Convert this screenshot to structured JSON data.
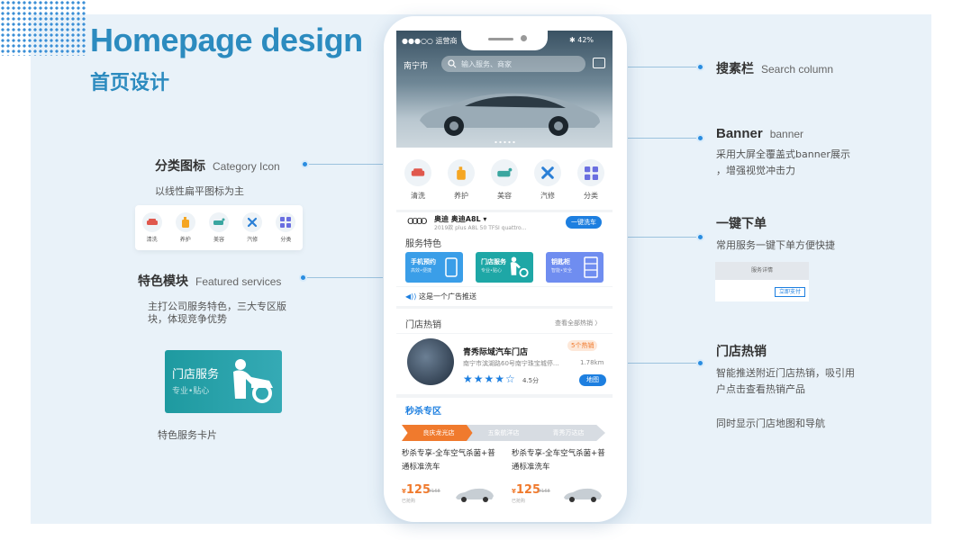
{
  "header": {
    "title_en": "Homepage design",
    "title_cn": "首页设计"
  },
  "annotations": {
    "category": {
      "title": "分类图标",
      "sub": "Category Icon",
      "desc": "以线性扁平图标为主"
    },
    "featured": {
      "title": "特色模块",
      "sub": "Featured services",
      "desc1": "主打公司服务特色，三大专区版",
      "desc2": "块，体现竞争优势"
    },
    "card_caption": "特色服务卡片",
    "search": {
      "title": "搜素栏",
      "sub": "Search column"
    },
    "banner": {
      "title": "Banner",
      "sub": "banner",
      "desc1": "采用大屏全覆盖式banner展示",
      "desc2": "，增强视觉冲击力"
    },
    "onekey": {
      "title": "一键下单",
      "desc": "常用服务一键下单方便快捷"
    },
    "hot": {
      "title": "门店热销",
      "desc1": "智能推送附近门店热销，吸引用",
      "desc2": "户点击查看热销产品",
      "desc3": "同时显示门店地图和导航"
    }
  },
  "phone": {
    "carrier": "●●●○○ 运营商",
    "battery": "✱ 42%",
    "city": "南宁市",
    "search_placeholder": "输入服务、商家",
    "categories": [
      {
        "label": "清洗",
        "icon": "car-wash-icon",
        "color": "#e0584d"
      },
      {
        "label": "养护",
        "icon": "oil-bottle-icon",
        "color": "#f5a623"
      },
      {
        "label": "美容",
        "icon": "car-beauty-icon",
        "color": "#3aa6a0"
      },
      {
        "label": "汽修",
        "icon": "wrench-icon",
        "color": "#2a7fd6"
      },
      {
        "label": "分类",
        "icon": "grid-icon",
        "color": "#6a6fe0"
      }
    ],
    "car": {
      "brand_logo": "OOOO",
      "name": "奥迪 奥迪A8L ▾",
      "desc": "2019款 plus  A8L 50 TFSI quattro...",
      "button": "一键洗车"
    },
    "service_title": "服务特色",
    "services": [
      {
        "title": "手机预约",
        "sub": "高效•便捷",
        "color": "#3a9ee8"
      },
      {
        "title": "门店服务",
        "sub": "专业•贴心",
        "color": "#1ea7a6"
      },
      {
        "title": "钥匙柜",
        "sub": "智能•安全",
        "color": "#6f8df0"
      }
    ],
    "ad_text": "这是一个广告推送",
    "store_section": "门店热销",
    "store_more": "查看全部热销 〉",
    "store": {
      "name": "青秀际域汽车门店",
      "badge": "5个热销",
      "address": "南宁市滨湖路60号南宁珠宝城停...",
      "distance": "1.78km",
      "rating": "4.5分",
      "map": "地图"
    },
    "flash_title": "秒杀专区",
    "flash_tabs": [
      "良庆龙光店",
      "五象航洋店",
      "青秀万达店"
    ],
    "deals": [
      {
        "title": "秒杀专享-全车空气杀菌+普通标准洗车",
        "price": "125",
        "old": "¥168",
        "sold": "已抢购"
      },
      {
        "title": "秒杀专享-全车空气杀菌+普通标准洗车",
        "price": "125",
        "old": "¥168",
        "sold": "已抢购"
      }
    ]
  },
  "feature_card": {
    "title": "门店服务",
    "sub": "专业•贴心"
  },
  "mini_detail": {
    "title": "服务详情",
    "button": "立即支付"
  }
}
